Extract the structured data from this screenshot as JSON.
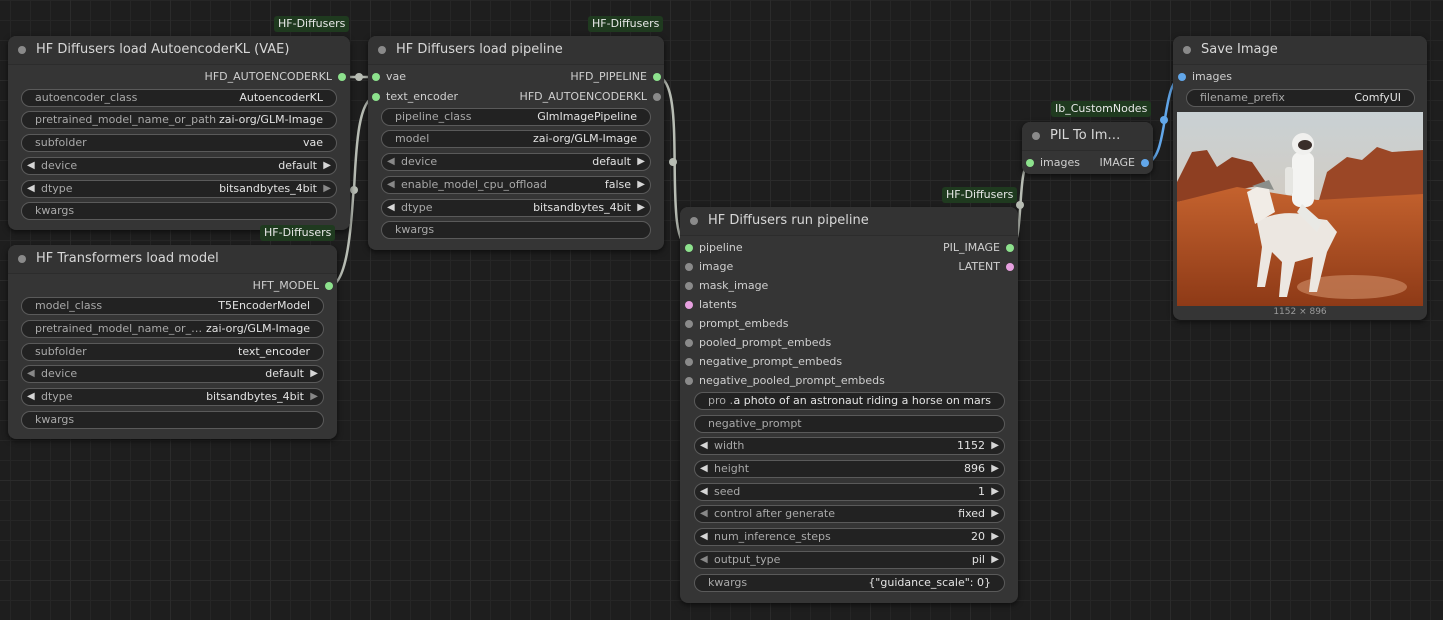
{
  "nodes": {
    "vae": {
      "title": "HF Diffusers load AutoencoderKL (VAE)",
      "badge": "HF-Diffusers",
      "output": "HFD_AUTOENCODERKL",
      "widgets": {
        "autoencoder_class": {
          "label": "autoencoder_class",
          "value": "AutoencoderKL"
        },
        "pretrained": {
          "label": "pretrained_model_name_or_path",
          "value": "zai-org/GLM-Image"
        },
        "subfolder": {
          "label": "subfolder",
          "value": "vae"
        },
        "device": {
          "label": "device",
          "value": "default"
        },
        "dtype": {
          "label": "dtype",
          "value": "bitsandbytes_4bit"
        },
        "kwargs": {
          "label": "kwargs",
          "value": ""
        }
      }
    },
    "transformers": {
      "title": "HF Transformers load model",
      "badge": "HF-Diffusers",
      "output": "HFT_MODEL",
      "widgets": {
        "model_class": {
          "label": "model_class",
          "value": "T5EncoderModel"
        },
        "pretrained": {
          "label": "pretrained_model_name_or_…",
          "value": "zai-org/GLM-Image"
        },
        "subfolder": {
          "label": "subfolder",
          "value": "text_encoder"
        },
        "device": {
          "label": "device",
          "value": "default"
        },
        "dtype": {
          "label": "dtype",
          "value": "bitsandbytes_4bit"
        },
        "kwargs": {
          "label": "kwargs",
          "value": ""
        }
      }
    },
    "pipeline": {
      "title": "HF Diffusers load pipeline",
      "badge": "HF-Diffusers",
      "inputs": {
        "vae": "vae",
        "text_encoder": "text_encoder"
      },
      "outputs": {
        "pipeline": "HFD_PIPELINE",
        "autoencoder": "HFD_AUTOENCODERKL"
      },
      "widgets": {
        "pipeline_class": {
          "label": "pipeline_class",
          "value": "GlmImagePipeline"
        },
        "model": {
          "label": "model",
          "value": "zai-org/GLM-Image"
        },
        "device": {
          "label": "device",
          "value": "default"
        },
        "offload": {
          "label": "enable_model_cpu_offload",
          "value": "false"
        },
        "dtype": {
          "label": "dtype",
          "value": "bitsandbytes_4bit"
        },
        "kwargs": {
          "label": "kwargs",
          "value": ""
        }
      }
    },
    "run": {
      "title": "HF Diffusers run pipeline",
      "badge": "HF-Diffusers",
      "inputs": [
        "pipeline",
        "image",
        "mask_image",
        "latents",
        "prompt_embeds",
        "pooled_prompt_embeds",
        "negative_prompt_embeds",
        "negative_pooled_prompt_embeds"
      ],
      "outputs": {
        "pil_image": "PIL_IMAGE",
        "latent": "LATENT"
      },
      "widgets": {
        "prompt": {
          "label": "pro …",
          "value": "a photo of an astronaut riding a horse on mars"
        },
        "negative_prompt": {
          "label": "negative_prompt",
          "value": ""
        },
        "width": {
          "label": "width",
          "value": "1152"
        },
        "height": {
          "label": "height",
          "value": "896"
        },
        "seed": {
          "label": "seed",
          "value": "1"
        },
        "control": {
          "label": "control after generate",
          "value": "fixed"
        },
        "steps": {
          "label": "num_inference_steps",
          "value": "20"
        },
        "output_type": {
          "label": "output_type",
          "value": "pil"
        },
        "kwargs": {
          "label": "kwargs",
          "value": "{\"guidance_scale\": 0}"
        }
      }
    },
    "pil": {
      "title": "PIL To Im…",
      "badge": "Ib_CustomNodes",
      "input": "images",
      "output": "IMAGE"
    },
    "save": {
      "title": "Save Image",
      "input": "images",
      "widgets": {
        "filename_prefix": {
          "label": "filename_prefix",
          "value": "ComfyUI"
        }
      },
      "preview_caption": "1152 × 896"
    }
  },
  "colors": {
    "canvas": "#1e1e1e",
    "node": "#353535",
    "link_default": "#b8bdb4",
    "link_image": "#62a7ea",
    "pin_green": "#8de28d",
    "pin_pink": "#e7a0e0"
  }
}
